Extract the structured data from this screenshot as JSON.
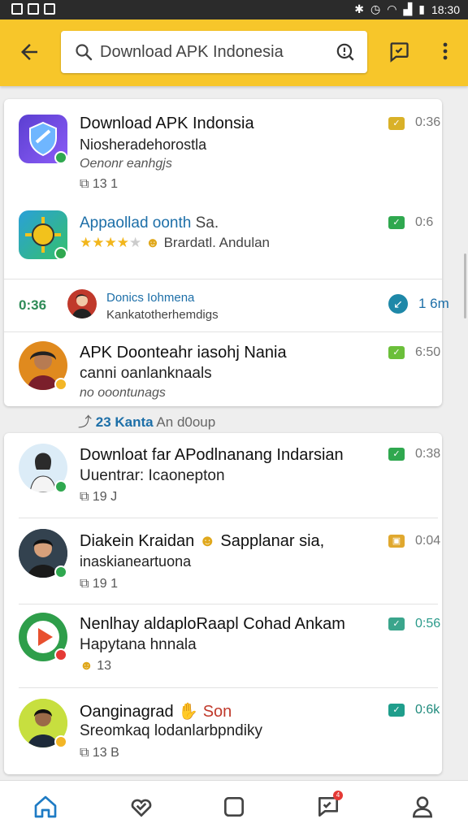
{
  "status_bar": {
    "time": "18:30"
  },
  "app_bar": {
    "search_value": "Download APK Indonesia"
  },
  "card1": {
    "items": [
      {
        "title": "Download APK Indonsia",
        "subtitle": "Niosheradehorostla",
        "meta": "Oenonr eanhgjs",
        "count": "13 1",
        "time": "0:36",
        "badge_color": "#d9b128",
        "dot_color": "#2fa84f"
      },
      {
        "title": "Appaollad oonth",
        "title_suffix": "Sa.",
        "rating_stars": 4,
        "rating_text": "Brardatl. Andulan",
        "time": "0:6",
        "badge_color": "#2fa84f",
        "dot_color": "#2fa84f"
      },
      {
        "left_time": "0:36",
        "title": "Donics Iohmena",
        "subtitle": "Kankatotherhemdigs",
        "time": "1 6m",
        "badge_color": "#1e88a8"
      },
      {
        "title": "APK Doonteahr iasohj Nania",
        "subtitle": "canni oanlanknaals",
        "meta": "no ooontunags",
        "time": "6:50",
        "badge_color": "#6bbf3a",
        "dot_color": "#f3b626"
      }
    ]
  },
  "group_label": {
    "prefix": "23",
    "accent": "Kanta",
    "text": "An d0oup"
  },
  "card2": {
    "items": [
      {
        "title": "Downloat far APodlnanang Indarsian",
        "subtitle": "Uuentrar: Icaonepton",
        "count": "19 J",
        "time": "0:38",
        "badge_color": "#2fa84f",
        "dot_color": "#2fa84f"
      },
      {
        "title": "Diakein Kraidan",
        "title_suffix": "Sapplanar sia,",
        "subtitle": "inaskianeartuona",
        "count": "19 1",
        "time": "0:04",
        "badge_color": "#e0a82e",
        "dot_color": "#2fa84f"
      },
      {
        "title": "Nenlhay aldaploRaapl Cohad Ankam",
        "subtitle": "Hapytana hnnala",
        "count": "13",
        "time": "0:56",
        "badge_color": "#3aa58c",
        "dot_color": "#e53935"
      },
      {
        "title": "Oanginagrad",
        "title_suffix": "Son",
        "subtitle": "Sreomkaq lodanlarbpndiky",
        "count": "13 B",
        "time": "0:6k",
        "badge_color": "#1f9e8c",
        "dot_color": "#f3b626"
      }
    ]
  },
  "bottom_nav": {
    "notification_count": "4"
  }
}
